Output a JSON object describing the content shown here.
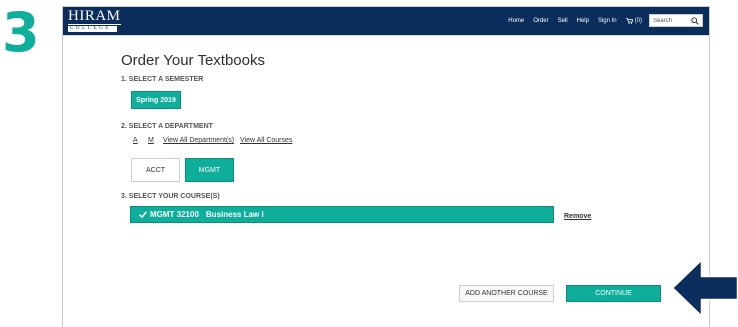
{
  "step": {
    "number": "3"
  },
  "header": {
    "logo_main": "HIRAM",
    "logo_sub": "COLLEGE",
    "nav": [
      "Home",
      "Order",
      "Sell",
      "Help",
      "Sign In"
    ],
    "cart_count": "(0)",
    "search_placeholder": "Search"
  },
  "page": {
    "title": "Order Your Textbooks"
  },
  "semester": {
    "label": "1. SELECT A SEMESTER",
    "selected": "Spring 2019"
  },
  "department": {
    "label": "2. SELECT A DEPARTMENT",
    "letters": [
      "A",
      "M"
    ],
    "view_all_departments": "View All Department(s)",
    "view_all_courses": "View All Courses",
    "options": [
      {
        "label": "ACCT",
        "selected": false
      },
      {
        "label": "MGMT",
        "selected": true
      }
    ]
  },
  "courses": {
    "label": "3. SELECT YOUR COURSE(S)",
    "selected_code": "MGMT 32100",
    "selected_name": "Business Law I",
    "remove_label": "Remove"
  },
  "actions": {
    "add_another": "ADD ANOTHER COURSE",
    "continue": "CONTINUE"
  },
  "colors": {
    "accent": "#0fae9a",
    "navbar": "#0b2d5b",
    "arrow": "#0b2d5b"
  },
  "icons": {
    "check": "checkmark-icon",
    "cart": "cart-icon",
    "search": "search-icon",
    "arrow": "left-arrow-icon"
  }
}
